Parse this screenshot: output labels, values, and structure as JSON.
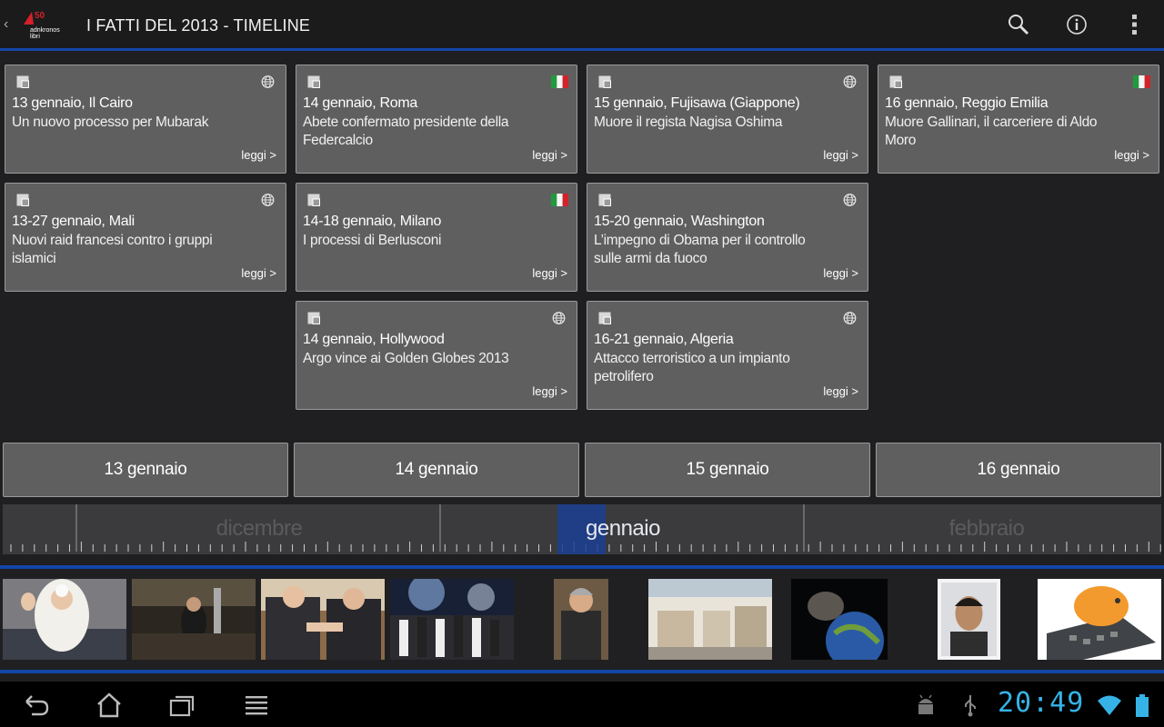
{
  "app": {
    "logo_text": "adnkronos libri",
    "logo_number": "50",
    "title": "I FATTI DEL 2013 - TIMELINE",
    "back_chevron": "‹",
    "actions": [
      "search-icon",
      "info-icon",
      "overflow-menu-icon"
    ]
  },
  "colors": {
    "accent": "#1346a8",
    "card_bg": "#5f5f60",
    "clock": "#36b3e6"
  },
  "cards": [
    {
      "title": "13 gennaio, Il Cairo",
      "desc": "Un nuovo processo per Mubarak",
      "marker": "globe-icon",
      "read": "leggi >"
    },
    {
      "title": "14 gennaio, Roma",
      "desc": "Abete confermato presidente della Federcalcio",
      "marker": "italy-flag-icon",
      "read": "leggi >"
    },
    {
      "title": "15 gennaio, Fujisawa (Giappone)",
      "desc": "Muore il regista Nagisa Oshima",
      "marker": "globe-icon",
      "read": "leggi >"
    },
    {
      "title": "16 gennaio, Reggio Emilia",
      "desc": "Muore Gallinari, il carceriere di Aldo Moro",
      "marker": "italy-flag-icon",
      "read": "leggi >"
    },
    {
      "title": "13-27 gennaio, Mali",
      "desc": "Nuovi raid francesi contro i gruppi islamici",
      "marker": "globe-icon",
      "read": "leggi >"
    },
    {
      "title": "14-18 gennaio, Milano",
      "desc": "I processi di Berlusconi",
      "marker": "italy-flag-icon",
      "read": "leggi >"
    },
    {
      "title": "15-20 gennaio, Washington",
      "desc": "L’impegno di Obama per il controllo sulle armi da fuoco",
      "marker": "globe-icon",
      "read": "leggi >"
    },
    {
      "title": "14 gennaio, Hollywood",
      "desc": "Argo vince ai Golden Globes 2013",
      "marker": "globe-icon",
      "read": "leggi >"
    },
    {
      "title": "16-21 gennaio, Algeria",
      "desc": "Attacco terroristico a un impianto petrolifero",
      "marker": "globe-icon",
      "read": "leggi >"
    }
  ],
  "days": [
    "13 gennaio",
    "14 gennaio",
    "15 gennaio",
    "16 gennaio"
  ],
  "timeline": {
    "months": [
      {
        "label": "dicembre",
        "current": false
      },
      {
        "label": "gennaio",
        "current": true
      },
      {
        "label": "febbraio",
        "current": false
      }
    ]
  },
  "thumbnails": [
    "pope-photo",
    "courtroom-photo",
    "handshake-photo",
    "football-celebration-photo",
    "man-portrait-photo",
    "storefront-photo",
    "asteroid-earth-photo",
    "mugshot-photo",
    "piggy-bank-calculator-photo"
  ],
  "system": {
    "clock": "20:49",
    "nav": [
      "back-icon",
      "home-icon",
      "recent-apps-icon",
      "menu-icon"
    ],
    "status": [
      "android-debug-icon",
      "usb-icon",
      "wifi-icon",
      "battery-icon"
    ]
  }
}
